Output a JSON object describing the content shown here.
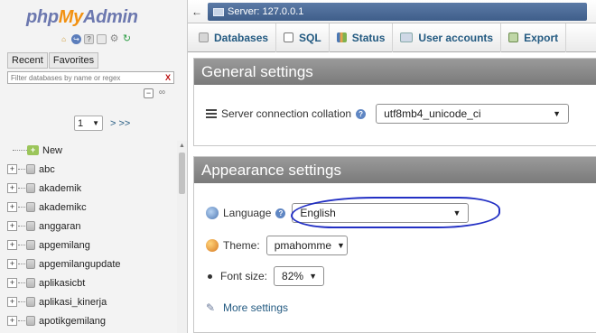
{
  "app": {
    "logo": {
      "php": "php",
      "my": "My",
      "admin": "Admin"
    }
  },
  "nav": {
    "quick_icons": [
      "home-icon",
      "exit-icon",
      "help-icon",
      "docs-icon",
      "settings-icon",
      "reload-icon"
    ],
    "tabs": [
      "Recent",
      "Favorites"
    ],
    "filter_placeholder": "Filter databases by name or regex",
    "filter_clear": "X",
    "page_value": "1",
    "page_next": "> >>",
    "new_label": "New",
    "databases": [
      "abc",
      "akademik",
      "akademikc",
      "anggaran",
      "apgemilang",
      "apgemilangupdate",
      "aplikasicbt",
      "aplikasi_kinerja",
      "apotikgemilang"
    ]
  },
  "breadcrumb": {
    "server_label": "Server: 127.0.0.1"
  },
  "tabs": [
    {
      "label": "Databases",
      "icon": "databases-icon"
    },
    {
      "label": "SQL",
      "icon": "sql-icon"
    },
    {
      "label": "Status",
      "icon": "status-icon"
    },
    {
      "label": "User accounts",
      "icon": "users-icon"
    },
    {
      "label": "Export",
      "icon": "export-icon"
    }
  ],
  "general": {
    "title": "General settings",
    "collation_label": "Server connection collation",
    "collation_value": "utf8mb4_unicode_ci"
  },
  "appearance": {
    "title": "Appearance settings",
    "language_label": "Language",
    "language_value": "English",
    "theme_label": "Theme:",
    "theme_value": "pmahomme",
    "fontsize_label": "Font size:",
    "fontsize_value": "82%",
    "more_settings": "More settings"
  },
  "annotation": {
    "color": "#2330c4"
  }
}
